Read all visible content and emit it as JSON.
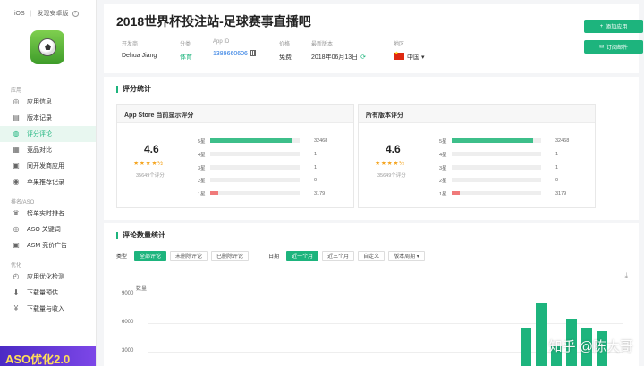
{
  "sidebar": {
    "platform": "iOS",
    "android_link": "发现安卓版",
    "app_icon": "football-icon",
    "groups": [
      {
        "label": "应用",
        "items": [
          "应用信息",
          "版本记录",
          "评分评论",
          "竞品对比",
          "同开发商应用",
          "苹果推荐记录"
        ]
      },
      {
        "label": "排名/ASO",
        "items": [
          "榜单实时排名",
          "ASO 关键词",
          "ASM 竞价广告"
        ]
      },
      {
        "label": "优化",
        "items": [
          "应用优化检测",
          "下载量预估",
          "下载量与收入"
        ]
      }
    ],
    "active_item": "评分评论",
    "banner": "ASO优化2.0"
  },
  "header": {
    "title": "2018世界杯投注站-足球赛事直播吧",
    "developer_label": "开发商",
    "developer": "Dehua Jiang",
    "category_label": "分类",
    "category": "体育",
    "appid_label": "App ID",
    "appid": "1389660606",
    "price_label": "价格",
    "price": "免费",
    "version_label": "最新版本",
    "version": "2018年06月13日",
    "region_label": "地区",
    "region": "中国",
    "add_button": "添加应用",
    "subscribe_button": "订阅邮件"
  },
  "ratings": {
    "section_title": "评分统计",
    "boxes": [
      {
        "title": "App Store 当前显示评分",
        "score": "4.6",
        "stars": "★★★★½",
        "count": "35649个评分",
        "rows": [
          {
            "label": "5星",
            "count": "32468",
            "fraction": 0.91,
            "color": "#3dbf8a"
          },
          {
            "label": "4星",
            "count": "1",
            "fraction": 0,
            "color": "#3dbf8a"
          },
          {
            "label": "3星",
            "count": "1",
            "fraction": 0,
            "color": "#3dbf8a"
          },
          {
            "label": "2星",
            "count": "0",
            "fraction": 0,
            "color": "#3dbf8a"
          },
          {
            "label": "1星",
            "count": "3179",
            "fraction": 0.09,
            "color": "#f07a7a"
          }
        ]
      },
      {
        "title": "所有版本评分",
        "score": "4.6",
        "stars": "★★★★½",
        "count": "35649个评分",
        "rows": [
          {
            "label": "5星",
            "count": "32468",
            "fraction": 0.91,
            "color": "#3dbf8a"
          },
          {
            "label": "4星",
            "count": "1",
            "fraction": 0,
            "color": "#3dbf8a"
          },
          {
            "label": "3星",
            "count": "1",
            "fraction": 0,
            "color": "#3dbf8a"
          },
          {
            "label": "2星",
            "count": "0",
            "fraction": 0,
            "color": "#3dbf8a"
          },
          {
            "label": "1星",
            "count": "3179",
            "fraction": 0.09,
            "color": "#f07a7a"
          }
        ]
      }
    ]
  },
  "reviews": {
    "section_title": "评论数量统计",
    "type_label": "类型",
    "type_options": [
      "全部评论",
      "未删除评论",
      "已删除评论"
    ],
    "type_selected": 0,
    "date_label": "日期",
    "date_options": [
      "近一个月",
      "近三个月",
      "自定义",
      "版本周期 ▾"
    ],
    "date_selected": 0
  },
  "chart_data": {
    "type": "bar",
    "ylabel": "数量",
    "yticks": [
      "9000",
      "6000",
      "3000"
    ],
    "ylim": [
      0,
      10000
    ],
    "values": [
      5500,
      8200,
      3600,
      6500,
      5500,
      5200
    ]
  },
  "watermark": "知乎 @陈大哥",
  "colors": {
    "accent": "#1db47d",
    "negative": "#f07a7a"
  }
}
